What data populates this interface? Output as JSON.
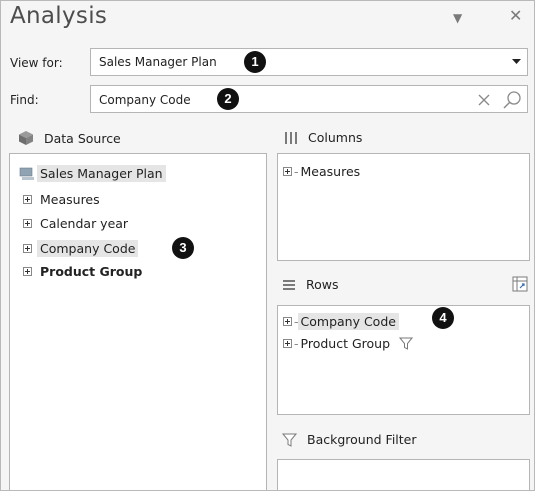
{
  "header": {
    "title": "Analysis"
  },
  "view_for": {
    "label": "View for:",
    "value": "Sales Manager Plan",
    "marker": "1"
  },
  "find": {
    "label": "Find:",
    "value": "Company Code",
    "marker": "2"
  },
  "data_source": {
    "heading": "Data Source",
    "root": "Sales Manager Plan",
    "items": [
      "Measures",
      "Calendar year",
      "Company Code",
      "Product Group"
    ],
    "marker": "3"
  },
  "columns": {
    "heading": "Columns",
    "items": [
      "Measures"
    ]
  },
  "rows": {
    "heading": "Rows",
    "items": [
      "Company Code",
      "Product Group"
    ],
    "marker": "4"
  },
  "background_filter": {
    "heading": "Background Filter"
  },
  "icons": {
    "pin": "pin-dropdown-icon",
    "close": "close-icon",
    "dropdown": "chevron-down-icon",
    "clear": "clear-icon",
    "search": "search-icon",
    "data_source": "cube-icon",
    "columns": "columns-icon",
    "rows": "rows-icon",
    "swap": "swap-axes-icon",
    "filter": "filter-icon"
  },
  "colors": {
    "panel_bg": "#f5f5f5",
    "highlight": "#e5e5e5",
    "marker": "#111111"
  }
}
